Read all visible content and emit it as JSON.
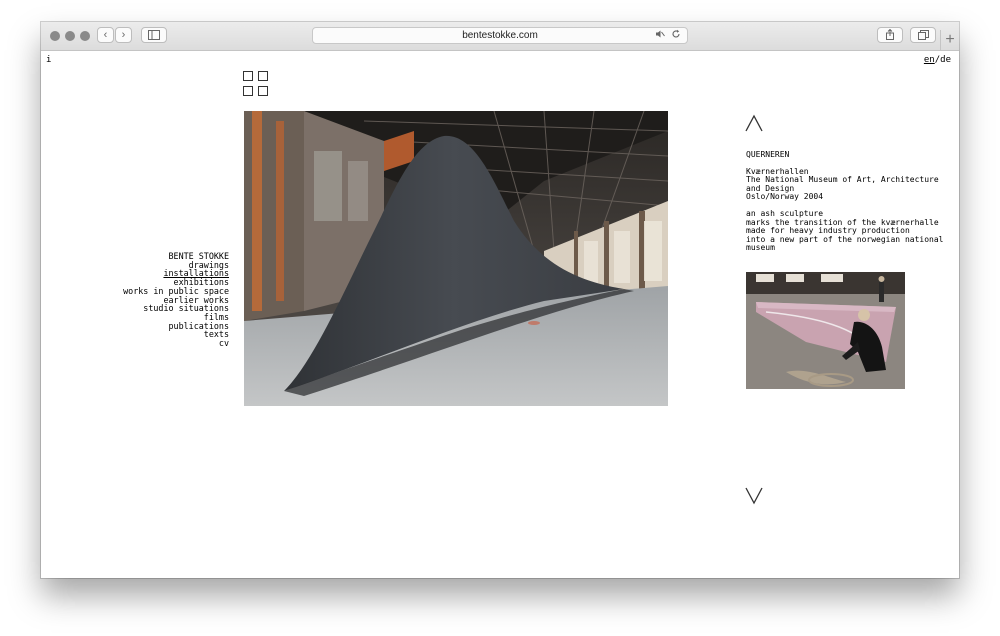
{
  "browser": {
    "url": "bentestokke.com",
    "back_glyph": "‹",
    "forward_glyph": "›",
    "new_tab_glyph": "+",
    "icons": [
      "sidebar-icon",
      "mute-icon",
      "reload-icon",
      "share-icon",
      "tabs-icon"
    ]
  },
  "page": {
    "info_link": "i",
    "lang_en": "en",
    "lang_sep": "/",
    "lang_de": "de"
  },
  "nav": {
    "title": "BENTE STOKKE",
    "items": [
      "drawings",
      "installations",
      "exhibitions",
      "works in public space",
      "earlier works",
      "studio situations",
      "films",
      "publications",
      "texts",
      "cv"
    ],
    "current": "installations"
  },
  "work": {
    "title": "QUERNEREN",
    "venue_lines": [
      "Kværnerhallen",
      "The National Museum of Art, Architecture",
      "and Design",
      "Oslo/Norway 2004"
    ],
    "desc_lines": [
      "an ash sculpture",
      "marks the transition of the kværnerhalle",
      "made for heavy industry production",
      "into a new part of the norwegian national",
      "museum"
    ]
  },
  "colors": {
    "toolbar": "#dcdcdc",
    "text": "#000000",
    "icon": "#333333"
  }
}
